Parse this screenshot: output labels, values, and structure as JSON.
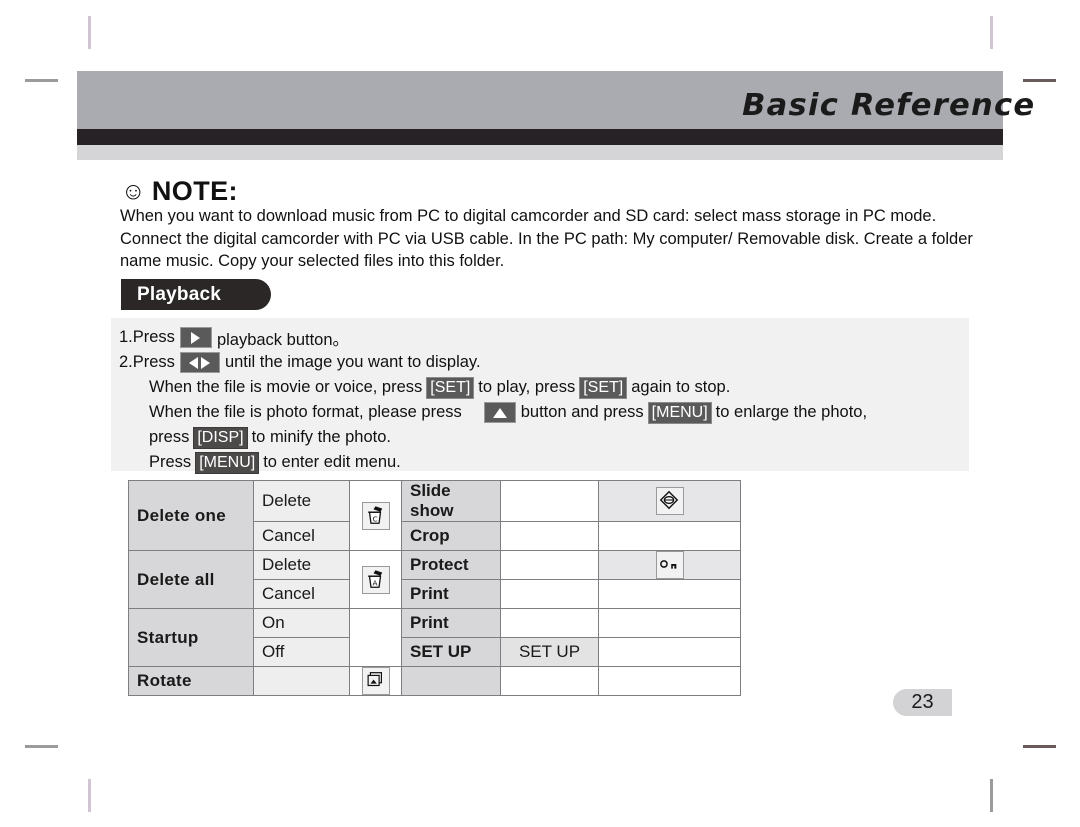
{
  "header": {
    "title": "Basic Reference"
  },
  "note": {
    "icon": "smiley-face-icon",
    "heading": "NOTE:",
    "body": "When you want to download music from PC to digital camcorder and SD card: select mass storage in PC mode. Connect the digital camcorder with PC via USB cable. In the PC path: My computer/ Removable disk. Create a folder name music. Copy your selected files into this folder."
  },
  "section": {
    "badge_label": "Playback"
  },
  "instructions": {
    "line1": {
      "pre": "1.Press",
      "icon": "play-button-icon",
      "post": "playback button。"
    },
    "line2": {
      "pre": "2.Press",
      "icon": "left-right-arrow-icon",
      "post": "until the image you want to display."
    },
    "line3": {
      "a": "When the file is movie or voice, press",
      "key1": "[SET]",
      "b": "to play, press",
      "key2": "[SET]",
      "c": "again to stop."
    },
    "line4": {
      "a": "When the file is  photo format, please press",
      "icon": "up-arrow-icon",
      "b": "button and press",
      "key1": "[MENU]",
      "c": "to enlarge the photo,"
    },
    "line5": {
      "a": "press",
      "key1": "[DISP]",
      "b": "to minify the photo."
    },
    "line6": {
      "a": "Press",
      "key1": "[MENU]",
      "b": "to enter edit menu."
    }
  },
  "menu_table": {
    "rows": [
      {
        "label": "Delete one",
        "label_rowspan": 2,
        "option": "Delete",
        "icon": "trash-can-current-icon",
        "icon_rowspan": 2,
        "mid": "Slide show",
        "mid_value": "",
        "right_icon": "slideshow-diamond-icon",
        "right_shaded": true
      },
      {
        "option": "Cancel",
        "mid": "Crop",
        "mid_value": "",
        "right_icon": "",
        "right_shaded": false
      },
      {
        "label": "Delete all",
        "label_rowspan": 2,
        "option": "Delete",
        "icon": "trash-can-all-icon",
        "icon_rowspan": 2,
        "mid": "Protect",
        "mid_value": "",
        "right_icon": "key-protect-icon",
        "right_shaded": true
      },
      {
        "option": "Cancel",
        "mid": "Print",
        "mid_value": "",
        "right_icon": "",
        "right_shaded": false
      },
      {
        "label": "Startup",
        "label_rowspan": 2,
        "option": "On",
        "icon": "",
        "icon_rowspan": 2,
        "mid": "Print",
        "mid_value": "",
        "right_icon": "",
        "right_shaded": false
      },
      {
        "option": "Off",
        "mid": "SET UP",
        "mid_value": "SET UP",
        "right_icon": "",
        "right_shaded": false
      },
      {
        "label": "Rotate",
        "label_rowspan": 1,
        "option": "",
        "icon": "rotate-image-icon",
        "icon_rowspan": 1,
        "mid": "",
        "mid_value": "",
        "right_icon": "",
        "right_shaded": false
      }
    ]
  },
  "footer": {
    "page_number": "23"
  },
  "colors": {
    "header_band": "#a9abb1",
    "header_dark": "#262226",
    "header_light": "#d5d5d7",
    "badge_bg": "#2b2727",
    "instruction_bg": "#f1f1f1",
    "table_label_bg": "#d7d7d9",
    "page_badge_bg": "#d3d3d5"
  }
}
